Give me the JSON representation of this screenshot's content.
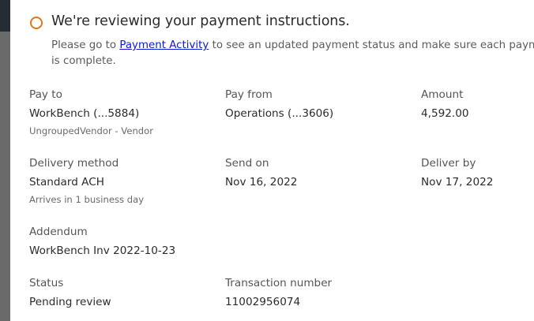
{
  "header": {
    "status_icon": "pending-ring-icon",
    "title": "We're reviewing your payment instructions.",
    "message_before_link": "Please go to ",
    "message_link": "Payment Activity",
    "message_after_link": " to see an updated payment status and make sure each payment is complete."
  },
  "details": {
    "pay_to": {
      "label": "Pay to",
      "value": "WorkBench (...5884)",
      "sub": "UngroupedVendor - Vendor"
    },
    "pay_from": {
      "label": "Pay from",
      "value": "Operations (...3606)"
    },
    "amount": {
      "label": "Amount",
      "value": "4,592.00"
    },
    "delivery_method": {
      "label": "Delivery method",
      "value": "Standard ACH",
      "sub": "Arrives in 1 business day"
    },
    "send_on": {
      "label": "Send on",
      "value": "Nov 16, 2022"
    },
    "deliver_by": {
      "label": "Deliver by",
      "value": "Nov 17, 2022"
    },
    "addendum": {
      "label": "Addendum",
      "value": "WorkBench Inv 2022-10-23"
    },
    "status": {
      "label": "Status",
      "value": "Pending review"
    },
    "transaction_number": {
      "label": "Transaction number",
      "value": "11002956074"
    }
  },
  "colors": {
    "status_accent": "#e2741b",
    "link": "#0a1ad6"
  }
}
